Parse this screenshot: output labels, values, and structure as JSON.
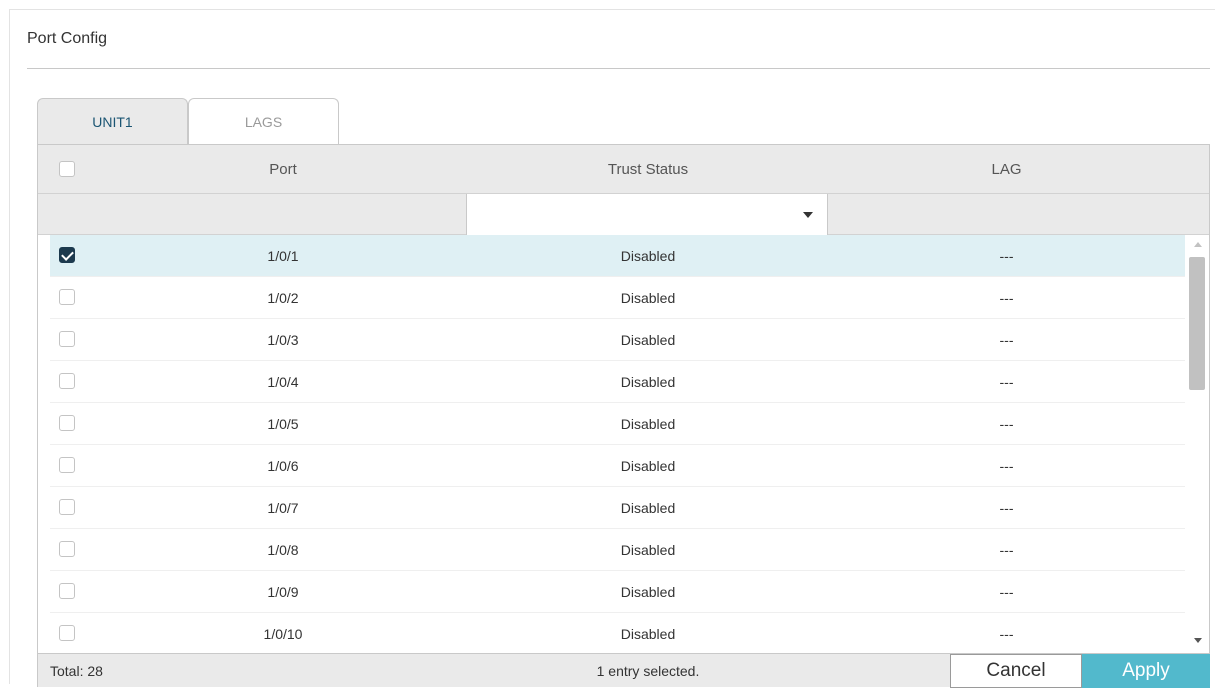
{
  "panel": {
    "title": "Port Config"
  },
  "tabs": [
    {
      "label": "UNIT1",
      "active": true
    },
    {
      "label": "LAGS",
      "active": false
    }
  ],
  "table": {
    "columns": [
      "Port",
      "Trust Status",
      "LAG"
    ],
    "filter": {
      "trust_status_value": ""
    },
    "rows": [
      {
        "checked": true,
        "port": "1/0/1",
        "trust_status": "Disabled",
        "lag": "---"
      },
      {
        "checked": false,
        "port": "1/0/2",
        "trust_status": "Disabled",
        "lag": "---"
      },
      {
        "checked": false,
        "port": "1/0/3",
        "trust_status": "Disabled",
        "lag": "---"
      },
      {
        "checked": false,
        "port": "1/0/4",
        "trust_status": "Disabled",
        "lag": "---"
      },
      {
        "checked": false,
        "port": "1/0/5",
        "trust_status": "Disabled",
        "lag": "---"
      },
      {
        "checked": false,
        "port": "1/0/6",
        "trust_status": "Disabled",
        "lag": "---"
      },
      {
        "checked": false,
        "port": "1/0/7",
        "trust_status": "Disabled",
        "lag": "---"
      },
      {
        "checked": false,
        "port": "1/0/8",
        "trust_status": "Disabled",
        "lag": "---"
      },
      {
        "checked": false,
        "port": "1/0/9",
        "trust_status": "Disabled",
        "lag": "---"
      },
      {
        "checked": false,
        "port": "1/0/10",
        "trust_status": "Disabled",
        "lag": "---"
      }
    ]
  },
  "footer": {
    "total": "Total: 28",
    "selected_info": "1 entry selected.",
    "cancel_label": "Cancel",
    "apply_label": "Apply"
  },
  "colors": {
    "accent": "#52b9cc",
    "selected_row": "#dff0f4",
    "active_tab_text": "#1b5573",
    "checkbox_checked": "#1d3a4e"
  },
  "icons": {
    "dropdown": "chevron-down-icon",
    "scroll_up": "arrow-up-icon",
    "scroll_down": "arrow-down-icon",
    "checkbox_check": "check-icon"
  }
}
